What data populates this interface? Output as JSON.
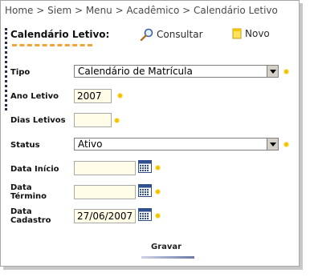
{
  "breadcrumb": "Home > Siem > Menu > Acadêmico > Calendário Letivo",
  "page_title": "Calendário Letivo:",
  "toolbar": {
    "consultar_label": "Consultar",
    "novo_label": "Novo"
  },
  "form": {
    "tipo": {
      "label": "Tipo",
      "value": "Calendário de Matrícula"
    },
    "ano_letivo": {
      "label": "Ano Letivo",
      "value": "2007"
    },
    "dias_letivos": {
      "label": "Dias Letivos",
      "value": ""
    },
    "status": {
      "label": "Status",
      "value": "Ativo"
    },
    "data_inicio": {
      "label": "Data Início",
      "value": ""
    },
    "data_termino": {
      "label_line1": "Data",
      "label_line2": "Término",
      "value": ""
    },
    "data_cadastro": {
      "label_line1": "Data",
      "label_line2": "Cadastro",
      "value": "27/06/2007"
    }
  },
  "gravar_label": "Gravar",
  "colors": {
    "required_bullet": "#f2c200",
    "title_underline": "#f4a23a",
    "input_background": "#fffde7"
  },
  "icons": [
    "magnifier-icon",
    "new-document-icon",
    "calendar-icon",
    "dropdown-arrow-icon",
    "required-bullet-icon"
  ]
}
